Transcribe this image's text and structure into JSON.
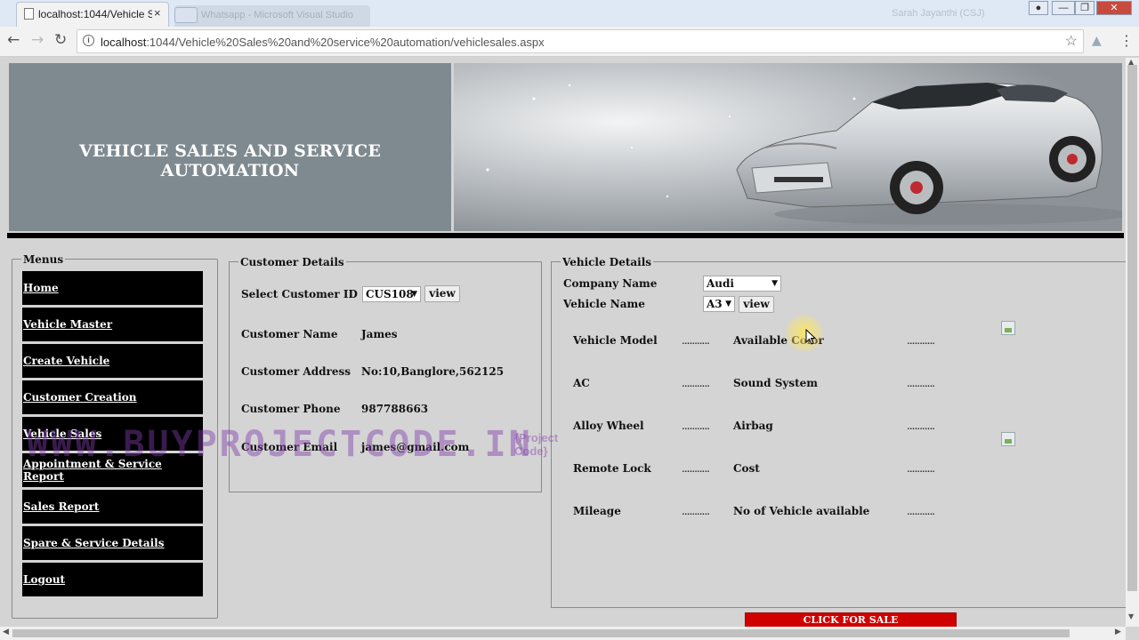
{
  "browser": {
    "tab_title": "localhost:1044/Vehicle S",
    "tab_close": "×",
    "second_tab_title": "Whatsapp - Microsoft Visual Studio",
    "window_user": "Sarah Jayanthi (CSJ)",
    "url_host": "localhost",
    "url_rest": ":1044/Vehicle%20Sales%20and%20service%20automation/vehiclesales.aspx",
    "back": "←",
    "forward": "→",
    "reload": "↻",
    "star": "☆",
    "menu": "⋮",
    "win_minimize": "—",
    "win_maximize": "❐",
    "win_close": "✕"
  },
  "header": {
    "title": "VEHICLE SALES AND SERVICE AUTOMATION"
  },
  "sidebar": {
    "legend": "Menus",
    "items": [
      {
        "label": "Home"
      },
      {
        "label": "Vehicle Master"
      },
      {
        "label": "Create Vehicle"
      },
      {
        "label": "Customer Creation"
      },
      {
        "label": "Vehicle Sales"
      },
      {
        "label": "Appointment & Service Report"
      },
      {
        "label": "Sales Report"
      },
      {
        "label": "Spare & Service Details"
      },
      {
        "label": "Logout"
      }
    ]
  },
  "customer": {
    "legend": "Customer Details",
    "select_label": "Select Customer ID",
    "selected_id": "CUS108",
    "view_button": "view",
    "name_label": "Customer Name",
    "name_value": "James",
    "address_label": "Customer Address",
    "address_value": "No:10,Banglore,562125",
    "phone_label": "Customer Phone",
    "phone_value": "987788663",
    "email_label": "Customer Email",
    "email_value": "james@gmail.com"
  },
  "vehicle": {
    "legend": "Vehicle Details",
    "company_label": "Company Name",
    "company_value": "Audi",
    "name_label": "Vehicle Name",
    "name_value": "A3",
    "view_button": "view",
    "placeholder": "...........",
    "fields": {
      "model": "Vehicle Model",
      "color": "Available Color",
      "ac": "AC",
      "sound": "Sound System",
      "alloy": "Alloy Wheel",
      "airbag": "Airbag",
      "remote": "Remote Lock",
      "cost": "Cost",
      "mileage": "Mileage",
      "available": "No of Vehicle available"
    },
    "sale_button": "CLICK FOR SALE"
  },
  "watermark": {
    "text": "WWW.BUYPROJECTCODE.IN",
    "tag_line1": "{Project",
    "tag_line2": "Code}"
  },
  "colors": {
    "banner": "#7f8a90",
    "menu_bg": "#000000",
    "sale_button": "#d10000",
    "page_bg": "#d4d4d4"
  }
}
